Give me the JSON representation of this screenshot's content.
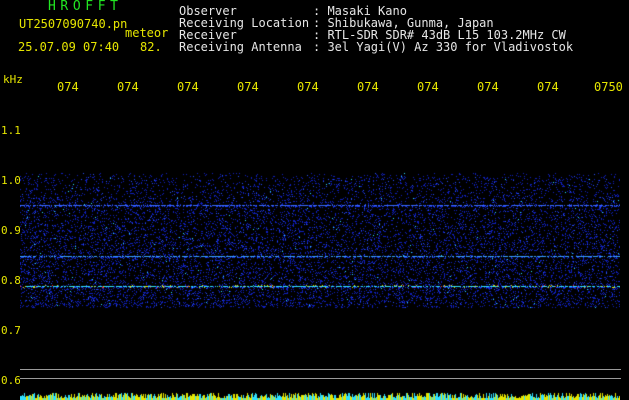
{
  "header": {
    "app_title": "HROFFT",
    "filename": "UT2507090740.pn",
    "meteor_label": "meteor",
    "datetime": "25.07.09 07:40",
    "count": "82."
  },
  "info": [
    {
      "label": "Observer",
      "value": ": Masaki Kano"
    },
    {
      "label": "Receiving Location",
      "value": ": Shibukawa, Gunma, Japan"
    },
    {
      "label": "Receiver",
      "value": ": RTL-SDR SDR# 43dB L15 103.2MHz CW"
    },
    {
      "label": "Receiving Antenna",
      "value": ": 3el Yagi(V) Az 330 for Vladivostok"
    }
  ],
  "axis": {
    "unit": "kHz",
    "time_ticks": [
      "074",
      "074",
      "074",
      "074",
      "074",
      "074",
      "074",
      "074",
      "074",
      "0750"
    ],
    "freq_ticks": [
      "1.1",
      "1.0",
      "0.9",
      "0.8",
      "0.7",
      "0.6"
    ]
  },
  "colors": {
    "title_green": "#22e622",
    "label_yellow": "#e6e600",
    "text_white": "#e6e6e6",
    "noise_blue": "#1020d0",
    "signal_cyan": "#30e0ff",
    "peak_red": "#ff3030"
  }
}
